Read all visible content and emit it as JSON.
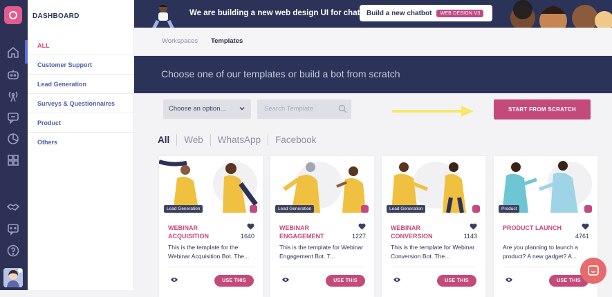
{
  "sidebar": {
    "header": "DASHBOARD",
    "items": [
      {
        "label": "ALL"
      },
      {
        "label": "Customer Support"
      },
      {
        "label": "Lead Generation"
      },
      {
        "label": "Surveys & Questionnaires"
      },
      {
        "label": "Product"
      },
      {
        "label": "Others"
      }
    ]
  },
  "banner": {
    "message": "We are building a new web design UI for chatbots",
    "cta_label": "Build a new chatbot",
    "cta_tag": "WEB DESIGN V3"
  },
  "tabs": [
    "Workspaces",
    "Templates"
  ],
  "hero_text": "Choose one of our templates or build a bot from scratch",
  "toolbar": {
    "dropdown_label": "Choose an option...",
    "search_placeholder": "Search Template",
    "scratch_label": "START FROM SCRATCH"
  },
  "filters": [
    "All",
    "Web",
    "WhatsApp",
    "Facebook"
  ],
  "cards": [
    {
      "category": "Lead Generation",
      "title": "WEBINAR ACQUISITION",
      "likes": "1640",
      "desc": "This is the template for the Webinar Acquisition Bot. The...",
      "use_label": "USE THIS"
    },
    {
      "category": "Lead Generation",
      "title": "WEBINAR ENGAGEMENT",
      "likes": "1227",
      "desc": "This is the template for Webinar Engagement Bot. T...",
      "use_label": "USE THIS"
    },
    {
      "category": "Lead Generation",
      "title": "WEBINAR CONVERSION",
      "likes": "1143",
      "desc": "This is the template for Webinar Conversion Bot. The...",
      "use_label": "USE THIS"
    },
    {
      "category": "Product",
      "title": "PRODUCT LAUNCH",
      "likes": "4761",
      "desc": "Are you planning to launch a product? A new gadget? A...",
      "use_label": "USE THIS"
    }
  ],
  "colors": {
    "accent": "#c44a7c",
    "navy": "#2b3358",
    "rail": "#2c3155",
    "arrow": "#f5e86a"
  }
}
